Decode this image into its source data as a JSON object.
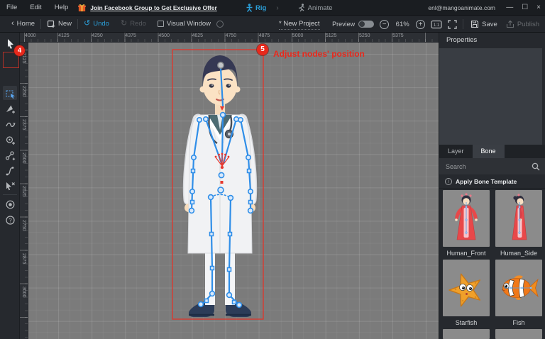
{
  "titlebar": {
    "menus": [
      "File",
      "Edit",
      "Help"
    ],
    "promo_link": "Join Facebook Group to Get Exclusive Offer",
    "rig_label": "Rig",
    "animate_label": "Animate",
    "account_email": "enl@mangoanimate.com"
  },
  "toolbar": {
    "home_label": "Home",
    "new_label": "New",
    "undo_label": "Undo",
    "redo_label": "Redo",
    "visual_window_label": "Visual Window",
    "project_name": "* New Project",
    "preview_label": "Preview",
    "zoom_level": "61%",
    "save_label": "Save",
    "publish_label": "Publish"
  },
  "icons": {
    "undo": "↺",
    "redo": "↻",
    "home_chevron": "‹",
    "zoom_out": "−",
    "zoom_in": "+",
    "minimize": "—",
    "maximize": "☐",
    "close": "×",
    "info": "i"
  },
  "rulers": {
    "horizontal": [
      "4000",
      "4125",
      "4250",
      "4375",
      "4500",
      "4625",
      "4750",
      "4875",
      "5000",
      "5125",
      "5250",
      "5375"
    ],
    "vertical": [
      "2125",
      "2250",
      "2375",
      "2500",
      "2625",
      "2750",
      "2875",
      "3000"
    ]
  },
  "annotations": {
    "step4_badge": "4",
    "step5_badge": "5",
    "step5_text": "Adjust nodes'  position"
  },
  "right_panel": {
    "properties_title": "Properties",
    "tabs": [
      {
        "label": "Layer",
        "active": false
      },
      {
        "label": "Bone",
        "active": true
      }
    ],
    "search_placeholder": "Search",
    "apply_bone_template": "Apply Bone Template",
    "templates": [
      {
        "name": "Human_Front"
      },
      {
        "name": "Human_Side"
      },
      {
        "name": "Starfish"
      },
      {
        "name": "Fish"
      }
    ]
  },
  "colors": {
    "accent_blue": "#2b9fd9",
    "rig_bone_blue": "#2f8ee8",
    "annotation_red": "#e8291c",
    "canvas_gray": "#7b7b7b",
    "panel_dark": "#26292e"
  }
}
